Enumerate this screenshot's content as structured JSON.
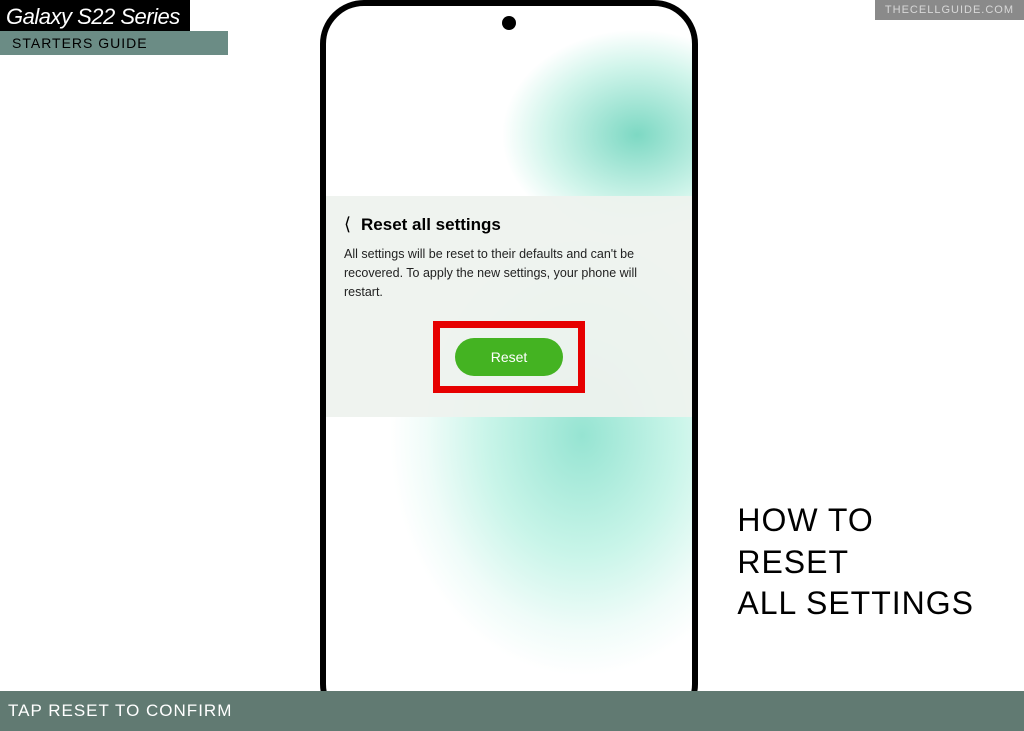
{
  "header": {
    "title": "Galaxy S22 Series",
    "subtitle": "STARTERS GUIDE"
  },
  "watermark": "THECELLGUIDE.COM",
  "phone_screen": {
    "panel_title": "Reset all settings",
    "panel_body": "All settings will be reset to their defaults and can't be recovered. To apply the new settings, your phone will restart.",
    "reset_button_label": "Reset"
  },
  "howto": {
    "line1": "HOW TO",
    "line2": "RESET",
    "line3": "ALL SETTINGS"
  },
  "footer": "TAP RESET TO CONFIRM"
}
